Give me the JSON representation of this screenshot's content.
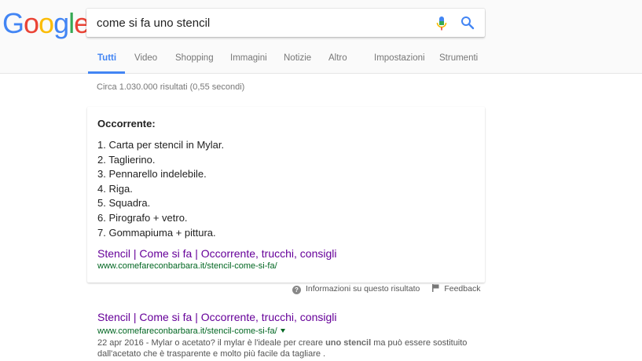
{
  "logo": {
    "letters": [
      "G",
      "o",
      "o",
      "g",
      "l",
      "e"
    ],
    "colors": [
      "#4285f4",
      "#ea4335",
      "#fbbc05",
      "#4285f4",
      "#34a853",
      "#ea4335"
    ]
  },
  "search": {
    "query": "come si fa uno stencil",
    "mic_icon": "microphone-icon",
    "search_icon": "search-icon"
  },
  "tabs": [
    {
      "label": "Tutti",
      "active": true
    },
    {
      "label": "Video"
    },
    {
      "label": "Shopping"
    },
    {
      "label": "Immagini"
    },
    {
      "label": "Notizie"
    },
    {
      "label": "Altro"
    },
    {
      "label": "Impostazioni"
    },
    {
      "label": "Strumenti"
    }
  ],
  "stats": "Circa 1.030.000 risultati (0,55 secondi)",
  "featured": {
    "heading": "Occorrente:",
    "items": [
      "1. Carta per stencil in Mylar.",
      "2. Taglierino.",
      "3. Pennarello indelebile.",
      "4. Riga.",
      "5. Squadra.",
      "6. Pirografo + vetro.",
      "7. Gommapiuma + pittura."
    ],
    "link_title": "Stencil | Come si fa | Occorrente, trucchi, consigli",
    "url": "www.comefareconbarbara.it/stencil-come-si-fa/"
  },
  "feedback": {
    "info_label": "Informazioni su questo risultato",
    "feedback_label": "Feedback"
  },
  "result": {
    "title": "Stencil | Come si fa | Occorrente, trucchi, consigli",
    "url": "www.comefareconbarbara.it/stencil-come-si-fa/",
    "snippet_before": "22 apr 2016 - Mylar o acetato? il mylar è l'ideale per creare ",
    "snippet_bold": "uno stencil",
    "snippet_after": " ma può essere sostituito dall'acetato che è trasparente e molto più facile da tagliare ."
  },
  "colors": {
    "accent": "#4285f4",
    "visited_link": "#660099",
    "url_green": "#006621"
  }
}
